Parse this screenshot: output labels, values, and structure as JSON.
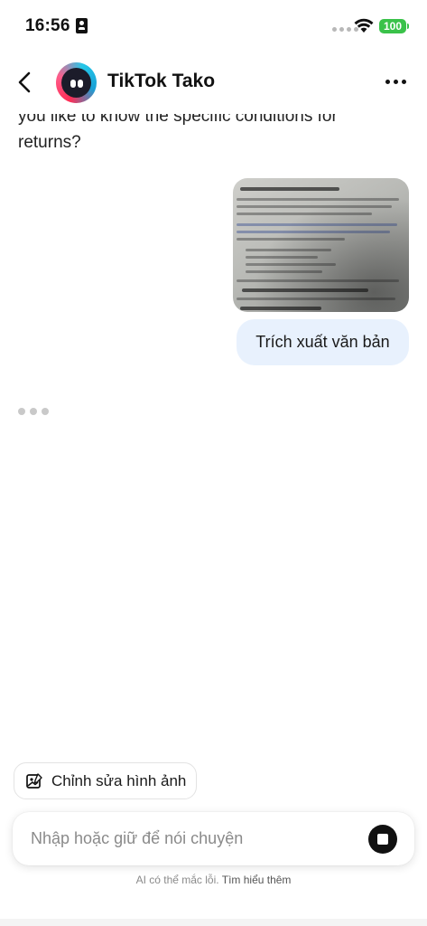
{
  "status_bar": {
    "time": "16:56",
    "battery": "100",
    "battery_color": "#3ac24a"
  },
  "header": {
    "title": "TikTok Tako",
    "back_icon": "chevron-left-icon",
    "more_icon": "ellipsis-icon"
  },
  "messages": {
    "bot_text": "you like to know the specific conditions for returns?",
    "user_image_icon": "photo-of-document",
    "user_text": "Trích xuất văn bản",
    "user_bubble_color": "#e8f1fd"
  },
  "bottom": {
    "edit_chip_label": "Chỉnh sửa hình ảnh",
    "input_placeholder": "Nhập hoặc giữ để nói chuyện",
    "disclaimer_text": "AI có thể mắc lỗi.",
    "learn_more": "Tìm hiểu thêm"
  }
}
